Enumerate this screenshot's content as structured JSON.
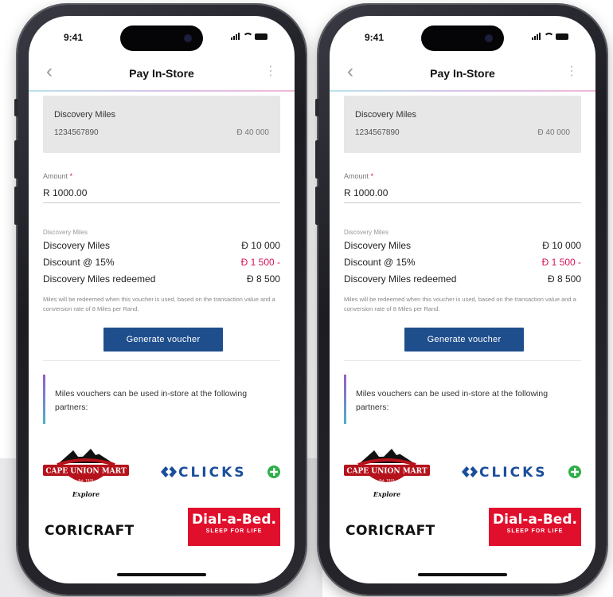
{
  "status": {
    "time": "9:41"
  },
  "nav": {
    "back": "‹",
    "title": "Pay In-Store",
    "more": "⋮"
  },
  "account": {
    "name": "Discovery Miles",
    "number": "1234567890",
    "balance": "Ð 40 000"
  },
  "amount": {
    "label": "Amount",
    "required": "*",
    "value": "R 1000.00"
  },
  "summary": {
    "section_label": "Discovery Miles",
    "rows": [
      {
        "label": "Discovery Miles",
        "value": "Ð 10 000"
      },
      {
        "label": "Discount @ 15%",
        "value": "Ð 1 500 -"
      },
      {
        "label": "Discovery Miles redeemed",
        "value": "Ð 8 500"
      }
    ],
    "disclaimer": "Miles will be redeemed when this voucher is used, based on the transaction value and a conversion rate of 8 Miles per Rand."
  },
  "actions": {
    "generate": "Generate voucher"
  },
  "partners": {
    "note": "Miles vouchers can be used in-store at the following partners:",
    "logos": {
      "cape_union_mart": {
        "name": "CAPE UNION MART",
        "est": "Est. 1933",
        "tag": "Explore"
      },
      "clicks": "CLICKS",
      "coricraft": "CORICRAFT",
      "dialabed": {
        "name": "Dial-a-Bed.",
        "tag": "SLEEP FOR LIFE"
      }
    }
  },
  "colors": {
    "primary_button": "#1f4e8c",
    "discount_red": "#d4145a",
    "dialabed_red": "#e0102d",
    "clicks_blue": "#1a4e9c",
    "clicks_green": "#2fae4a"
  }
}
